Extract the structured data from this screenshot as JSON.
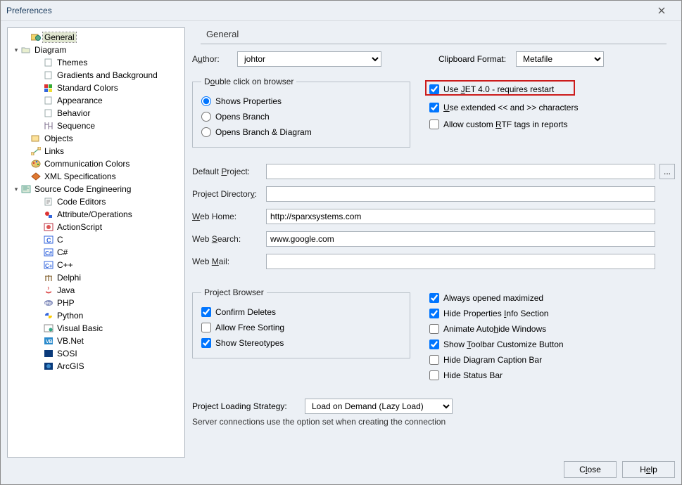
{
  "window": {
    "title": "Preferences"
  },
  "tree": {
    "general": "General",
    "diagram": "Diagram",
    "themes": "Themes",
    "gradients": "Gradients and Background",
    "standard_colors": "Standard Colors",
    "appearance": "Appearance",
    "behavior": "Behavior",
    "sequence": "Sequence",
    "objects": "Objects",
    "links": "Links",
    "comm_colors": "Communication Colors",
    "xml_spec": "XML Specifications",
    "sce": "Source Code Engineering",
    "code_editors": "Code Editors",
    "attr_ops": "Attribute/Operations",
    "actionscript": "ActionScript",
    "c": "C",
    "csharp": "C#",
    "cpp": "C++",
    "delphi": "Delphi",
    "java": "Java",
    "php": "PHP",
    "python": "Python",
    "vb": "Visual Basic",
    "vbnet": "VB.Net",
    "sosi": "SOSI",
    "arcgis": "ArcGIS"
  },
  "page": {
    "title": "General",
    "author_label_pre": "A",
    "author_label_u": "u",
    "author_label_post": "thor:",
    "author_value": "johtor",
    "clipboard_label": "Clipboard Format:",
    "clipboard_value": "Metafile",
    "double_click_legend_pre": "D",
    "double_click_legend_u": "o",
    "double_click_legend_post": "uble click on browser",
    "dc_shows_props": "Shows Properties",
    "dc_opens_branch": "Opens Branch",
    "dc_opens_branch_diag": "Opens Branch  & Diagram",
    "use_jet_pre": "Use ",
    "use_jet_u": "J",
    "use_jet_post": "ET 4.0 - requires restart",
    "use_ext_pre": "U",
    "use_ext_post": "se extended << and >> characters",
    "allow_rtf_pre": "Allow custom ",
    "allow_rtf_u": "R",
    "allow_rtf_post": "TF tags in reports",
    "default_project_pre": "Default ",
    "default_project_u": "P",
    "default_project_post": "roject:",
    "project_directory_pre": "Project Director",
    "project_directory_u": "y",
    "project_directory_post": ":",
    "web_home_pre": "W",
    "web_home_post": "eb Home:",
    "web_home_value": "http://sparxsystems.com",
    "web_search_pre": "Web ",
    "web_search_u": "S",
    "web_search_post": "earch:",
    "web_search_value": "www.google.com",
    "web_mail_pre": "Web ",
    "web_mail_u": "M",
    "web_mail_post": "ail:",
    "pb_legend": "Project Browser",
    "pb_confirm_deletes": "Confirm Deletes",
    "pb_free_sort": "Allow Free Sorting",
    "pb_stereotypes": "Show Stereotypes",
    "rc_max": "Always opened maximized",
    "rc_hide_info_pre": "Hide Properties ",
    "rc_hide_info_u": "I",
    "rc_hide_info_post": "nfo Section",
    "rc_anim_pre": "Animate Auto",
    "rc_anim_u": "h",
    "rc_anim_post": "ide Windows",
    "rc_toolbar_pre": "Show ",
    "rc_toolbar_u": "T",
    "rc_toolbar_post": "oolbar Customize Button",
    "rc_caption": "Hide Diagram Caption Bar",
    "rc_status": "Hide Status Bar",
    "pls_label": "Project Loading Strategy:",
    "pls_value": "Load on Demand (Lazy Load)",
    "server_note": "Server connections use the option set when creating the connection",
    "browse_btn": "..."
  },
  "buttons": {
    "close_pre": "C",
    "close_u": "l",
    "close_post": "ose",
    "help_pre": "H",
    "help_u": "e",
    "help_post": "lp"
  }
}
